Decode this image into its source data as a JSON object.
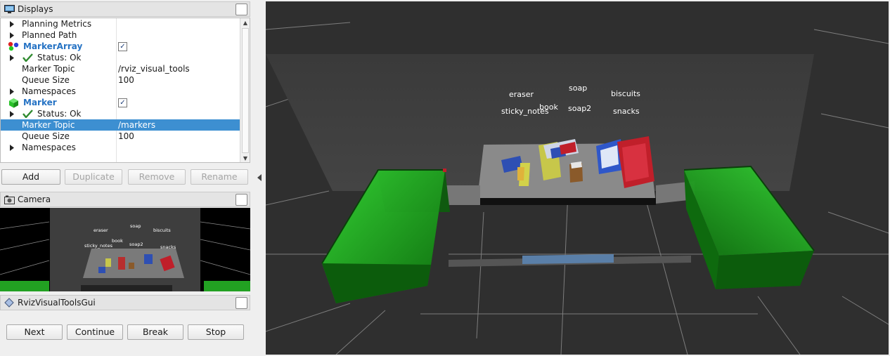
{
  "displays_panel": {
    "title": "Displays",
    "rows": [
      {
        "name": "Planning Metrics",
        "value": ""
      },
      {
        "name": "Planned Path",
        "value": ""
      },
      {
        "name": "MarkerArray",
        "value": ""
      },
      {
        "name": "Status: Ok",
        "value": ""
      },
      {
        "name": "Marker Topic",
        "value": "/rviz_visual_tools"
      },
      {
        "name": "Queue Size",
        "value": "100"
      },
      {
        "name": "Namespaces",
        "value": ""
      },
      {
        "name": "Marker",
        "value": ""
      },
      {
        "name": "Status: Ok",
        "value": ""
      },
      {
        "name": "Marker Topic",
        "value": "/markers"
      },
      {
        "name": "Queue Size",
        "value": "100"
      },
      {
        "name": "Namespaces",
        "value": ""
      }
    ],
    "selected_row": "Marker Topic (/markers)",
    "checkmark": "✓",
    "buttons": {
      "add": "Add",
      "duplicate": "Duplicate",
      "remove": "Remove",
      "rename": "Rename"
    }
  },
  "camera_panel": {
    "title": "Camera",
    "labels": [
      "eraser",
      "soap",
      "biscuits",
      "sticky_notes",
      "book",
      "soap2",
      "snacks"
    ]
  },
  "tools_panel": {
    "title": "RvizVisualToolsGui",
    "buttons": {
      "next": "Next",
      "continue": "Continue",
      "break": "Break",
      "stop": "Stop"
    }
  },
  "scene_3d": {
    "object_labels": {
      "eraser": "eraser",
      "soap": "soap",
      "biscuits": "biscuits",
      "sticky_notes": "sticky_notes",
      "book": "book",
      "soap2": "soap2",
      "snacks": "snacks"
    }
  },
  "colors": {
    "selection": "#3d8fd1",
    "display_name_blue": "#2673c4",
    "status_ok_green": "#2f8a2f",
    "bin_green": "#1fae1f",
    "background_3d": "#2f2f2f"
  }
}
